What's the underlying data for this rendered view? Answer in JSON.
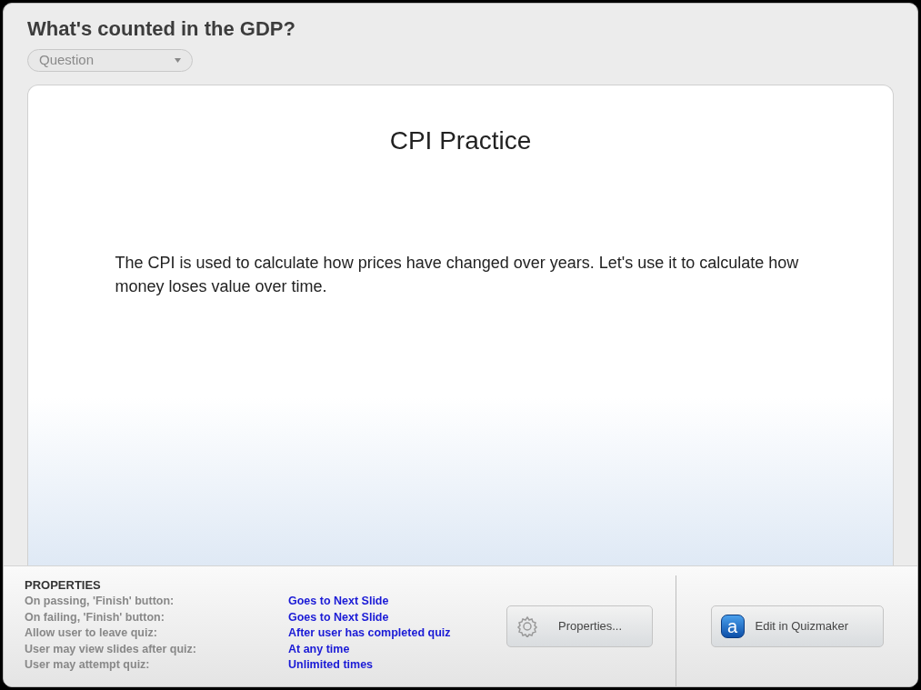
{
  "title": "What's counted in the GDP?",
  "slide_type": {
    "value": "Question"
  },
  "slide": {
    "heading": "CPI Practice",
    "body": "The CPI is used to calculate how prices have changed over years. Let's use it to calculate how money loses value over time."
  },
  "properties": {
    "heading": "PROPERTIES",
    "rows": [
      {
        "label": "On passing, 'Finish' button:",
        "value": "Goes to Next Slide"
      },
      {
        "label": "On failing, 'Finish' button:",
        "value": "Goes to Next Slide"
      },
      {
        "label": "Allow user to leave quiz:",
        "value": "After user has completed quiz"
      },
      {
        "label": "User may view slides after quiz:",
        "value": "At any time"
      },
      {
        "label": "User may attempt quiz:",
        "value": "Unlimited times"
      }
    ]
  },
  "buttons": {
    "properties": "Properties...",
    "edit": {
      "label": "Edit in Quizmaker",
      "logo_letter": "a"
    }
  }
}
